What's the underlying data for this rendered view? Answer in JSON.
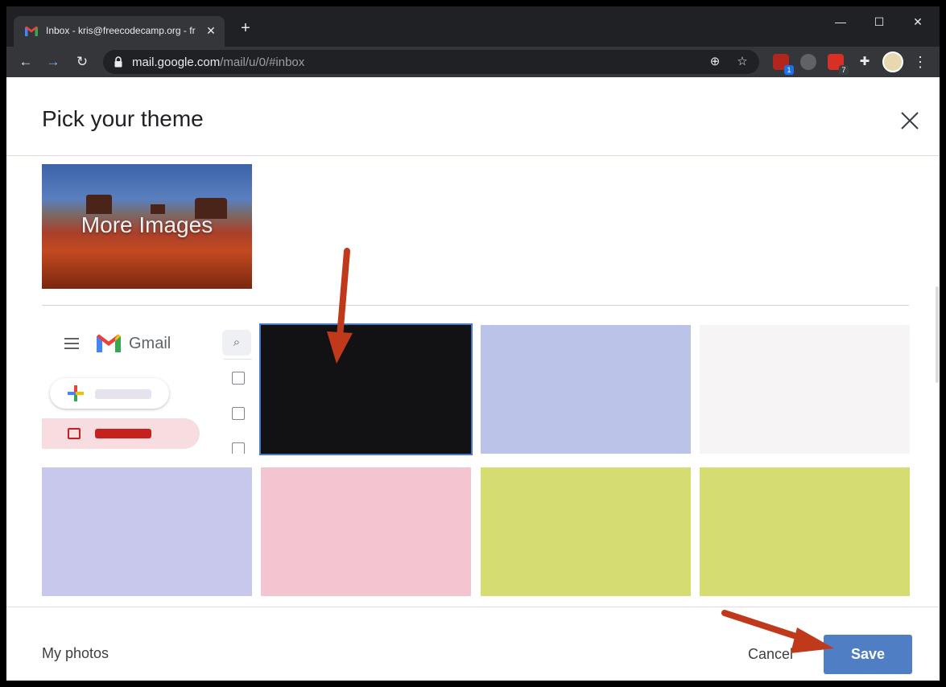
{
  "browser": {
    "tab_title": "Inbox - kris@freecodecamp.org - fr",
    "url_host": "mail.google.com",
    "url_path": "/mail/u/0/#inbox",
    "extension_badges": [
      "1",
      "7"
    ],
    "icons": [
      "gmail-favicon",
      "close-icon",
      "plus-icon",
      "minimize-icon",
      "maximize-icon",
      "window-close-icon",
      "back-arrow-icon",
      "forward-arrow-icon",
      "reload-icon",
      "lock-icon",
      "zoom-icon",
      "star-icon",
      "puzzle-icon",
      "kebab-menu-icon"
    ]
  },
  "dialog": {
    "title": "Pick your theme",
    "more_images_label": "More Images",
    "preview": {
      "app_name": "Gmail"
    },
    "themes": [
      {
        "color": "#121214",
        "selected": true
      },
      {
        "color": "#bbc4e8",
        "selected": false
      },
      {
        "color": "#f7f4f6",
        "selected": false
      },
      {
        "color": "#c8c8ec",
        "selected": false
      },
      {
        "color": "#f3c5d0",
        "selected": false
      },
      {
        "color": "#d5dc72",
        "selected": false
      },
      {
        "color": "#d5dc72",
        "selected": false
      }
    ],
    "footer": {
      "my_photos": "My photos",
      "cancel": "Cancel",
      "save": "Save"
    }
  },
  "annotations": {
    "arrow_color": "#c0391b"
  }
}
